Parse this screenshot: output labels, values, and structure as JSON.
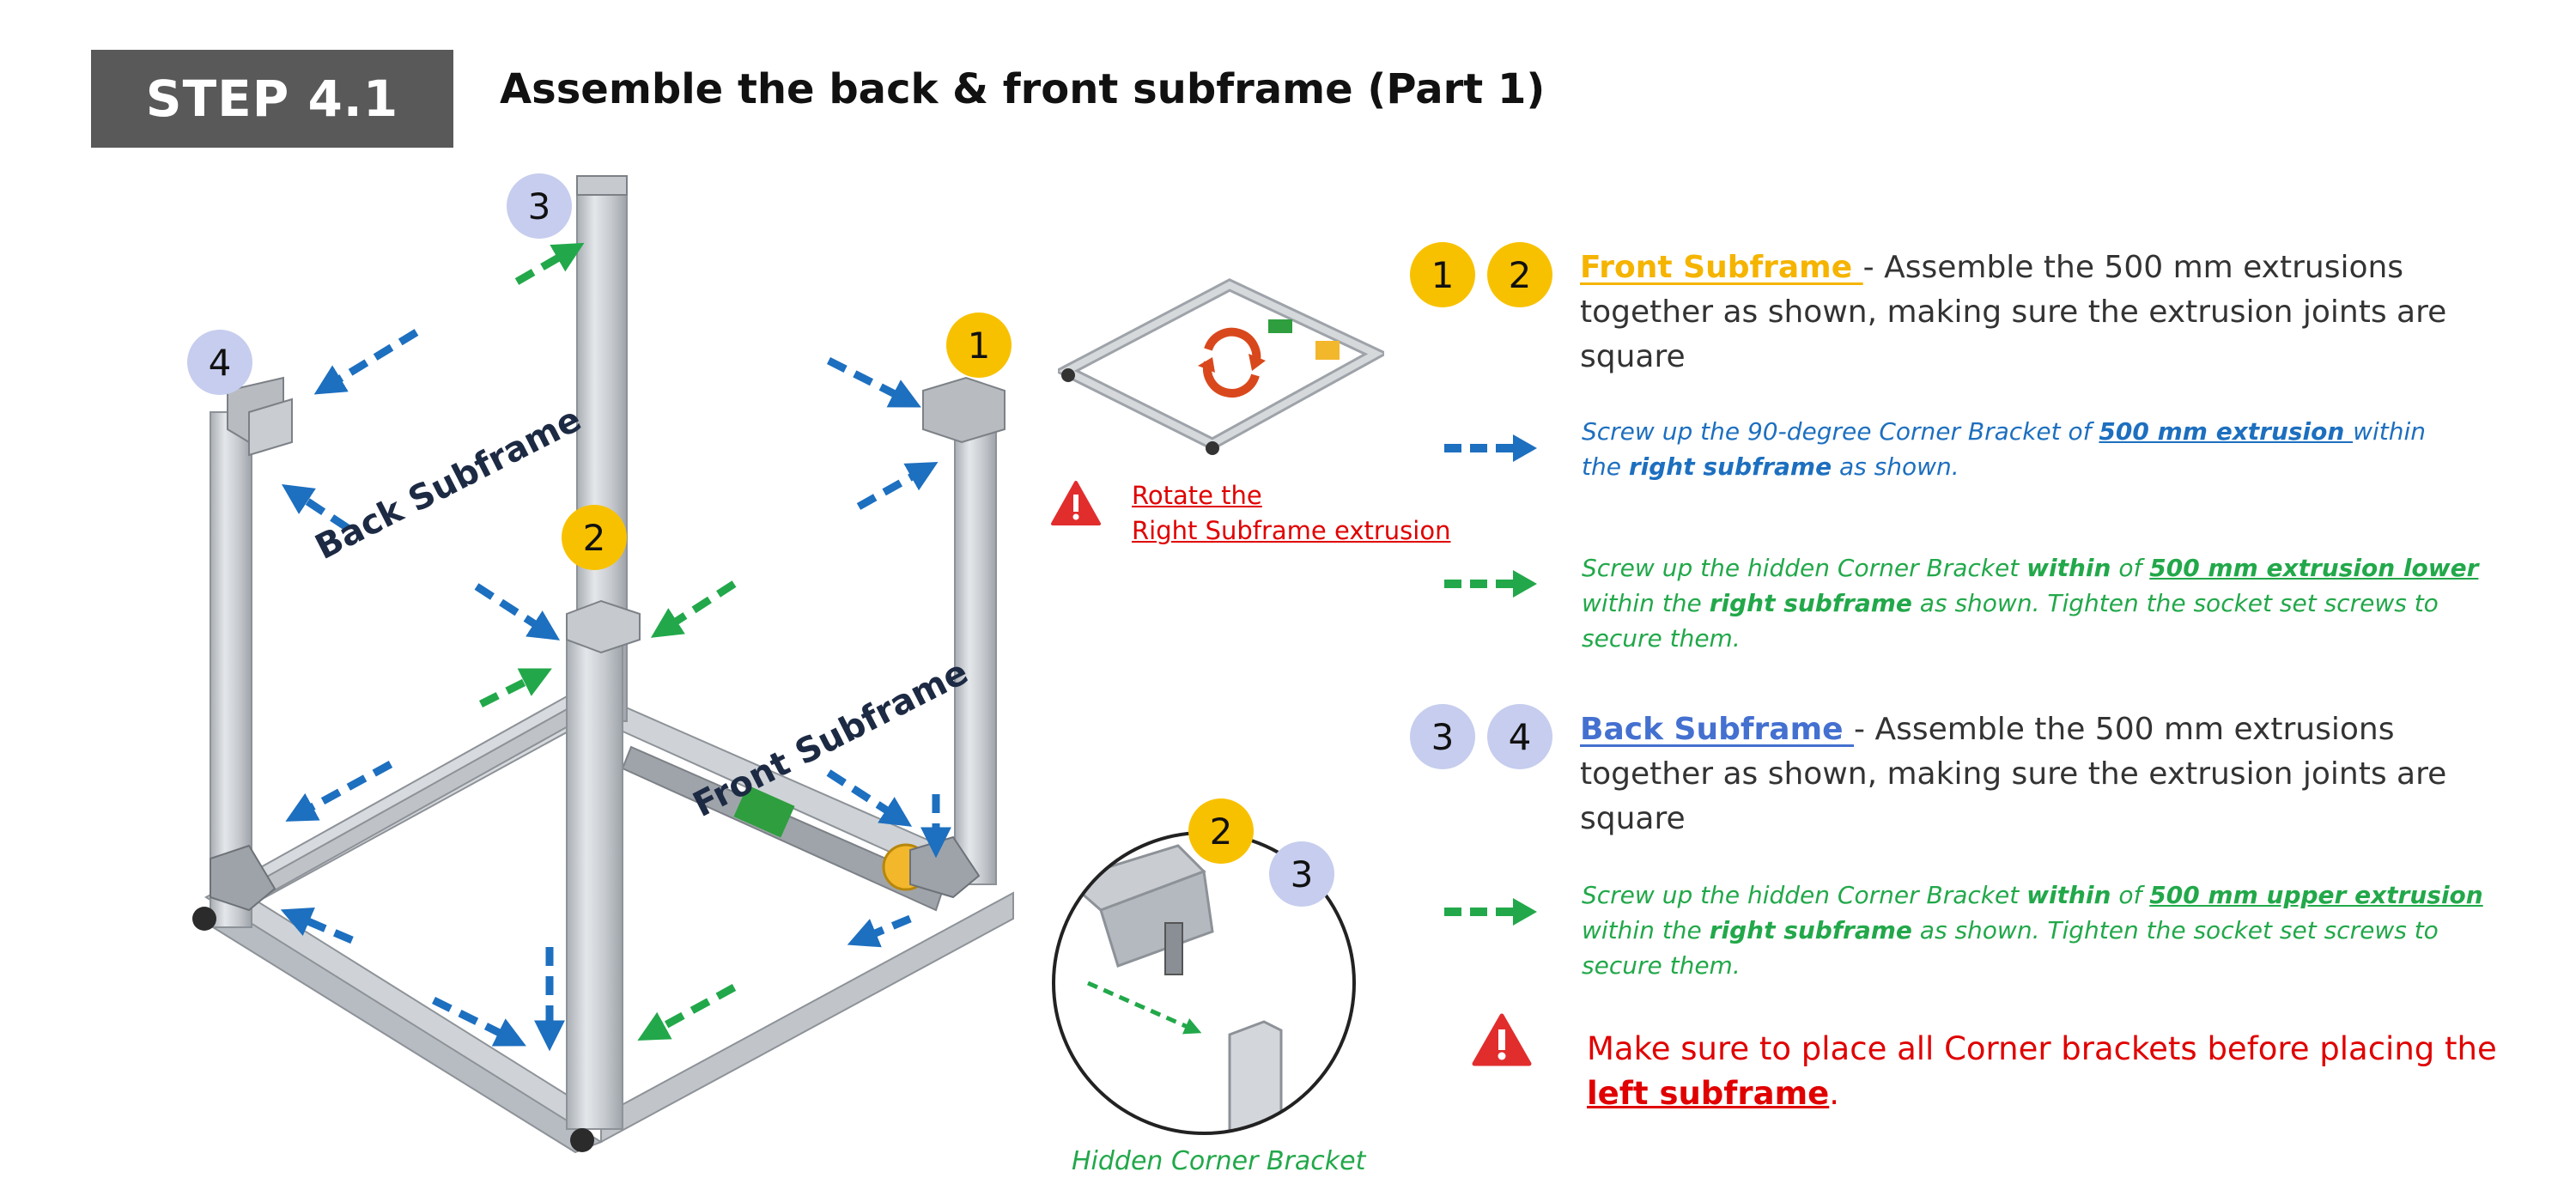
{
  "header": {
    "step_label": "STEP 4.1",
    "title": "Assemble the back & front subframe (Part 1)"
  },
  "colors": {
    "badge_gray": "#595959",
    "number_yellow": "#f8c100",
    "number_blue": "#c6cdee",
    "front_subframe_orange": "#f5b400",
    "back_subframe_blue": "#4470d0",
    "blue_arrow": "#1d6fbf",
    "green_arrow": "#22a84a",
    "warning_red": "#e00000",
    "extrusion_aluminum": "#c9cdd2"
  },
  "diagram": {
    "markers": [
      "4",
      "3",
      "1",
      "2"
    ],
    "labels": {
      "back_subframe": "Back Subframe",
      "front_subframe": "Front Subframe"
    },
    "icons": [
      "blue-dashed-arrow-icon",
      "green-dashed-arrow-icon",
      "rotate-icon",
      "warning-icon"
    ]
  },
  "thumbnail": {
    "rotate_note_line1": "Rotate the",
    "rotate_note_line2": "Right Subframe extrusion"
  },
  "detail": {
    "markers": [
      "2",
      "3"
    ],
    "caption": "Hidden Corner Bracket"
  },
  "instructions": {
    "front": {
      "numbers": [
        "1",
        "2"
      ],
      "heading": "Front Subframe ",
      "text_line1": "- Assemble the 500 mm extrusions",
      "text_line2": "together as shown, making sure the extrusion joints are",
      "text_line3": "square",
      "blue_note": {
        "part1": "Screw up the  90-degree Corner Bracket of ",
        "link": "500 mm extrusion ",
        "part2": "within",
        "part3": "the ",
        "bold": "right subframe",
        "part4": " as shown."
      },
      "green_note": {
        "part1": "Screw up the hidden Corner Bracket  ",
        "bold1": "within",
        "part2": " of ",
        "link": "500 mm extrusion lower",
        "part3": "within  the ",
        "bold2": "right subframe",
        "part4": " as shown.   Tighten the socket set screws to",
        "part5": "secure them."
      }
    },
    "back": {
      "numbers": [
        "3",
        "4"
      ],
      "heading": "Back Subframe ",
      "text_line1": "- Assemble the 500 mm extrusions",
      "text_line2": "together as shown, making sure the extrusion joints are",
      "text_line3": "square",
      "green_note": {
        "part1": "Screw up the hidden Corner Bracket  ",
        "bold1": "within",
        "part2": " of ",
        "link": "500 mm upper extrusion",
        "part3": "within  the ",
        "bold2": "right subframe",
        "part4": " as shown.   Tighten the socket set screws to",
        "part5": "secure them."
      }
    },
    "warning": {
      "text": "Make sure to place all Corner brackets before placing the",
      "link": "left subframe",
      "end": "."
    }
  }
}
